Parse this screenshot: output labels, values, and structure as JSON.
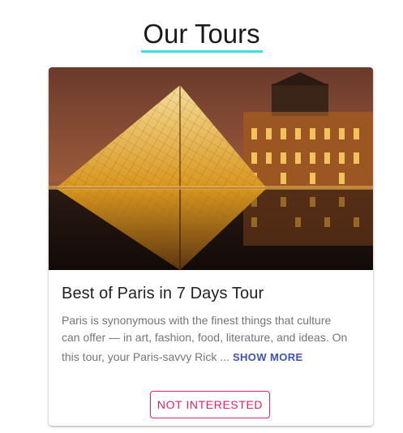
{
  "page": {
    "title": "Our Tours"
  },
  "card": {
    "image_description": "Louvre pyramid",
    "title": "Best of Paris in 7 Days Tour",
    "description_line1": "Paris is synonymous with the finest things that culture",
    "description_line2": "can offer — in art, fashion, food, literature, and ideas. On",
    "description_line3": "this tour, your Paris-savvy Rick ...",
    "show_more_label": "SHOW MORE",
    "button_label": "NOT INTERESTED"
  },
  "colors": {
    "accent_underline": "#3fe0e4",
    "link": "#3f51b5",
    "button": "#e91e63"
  }
}
